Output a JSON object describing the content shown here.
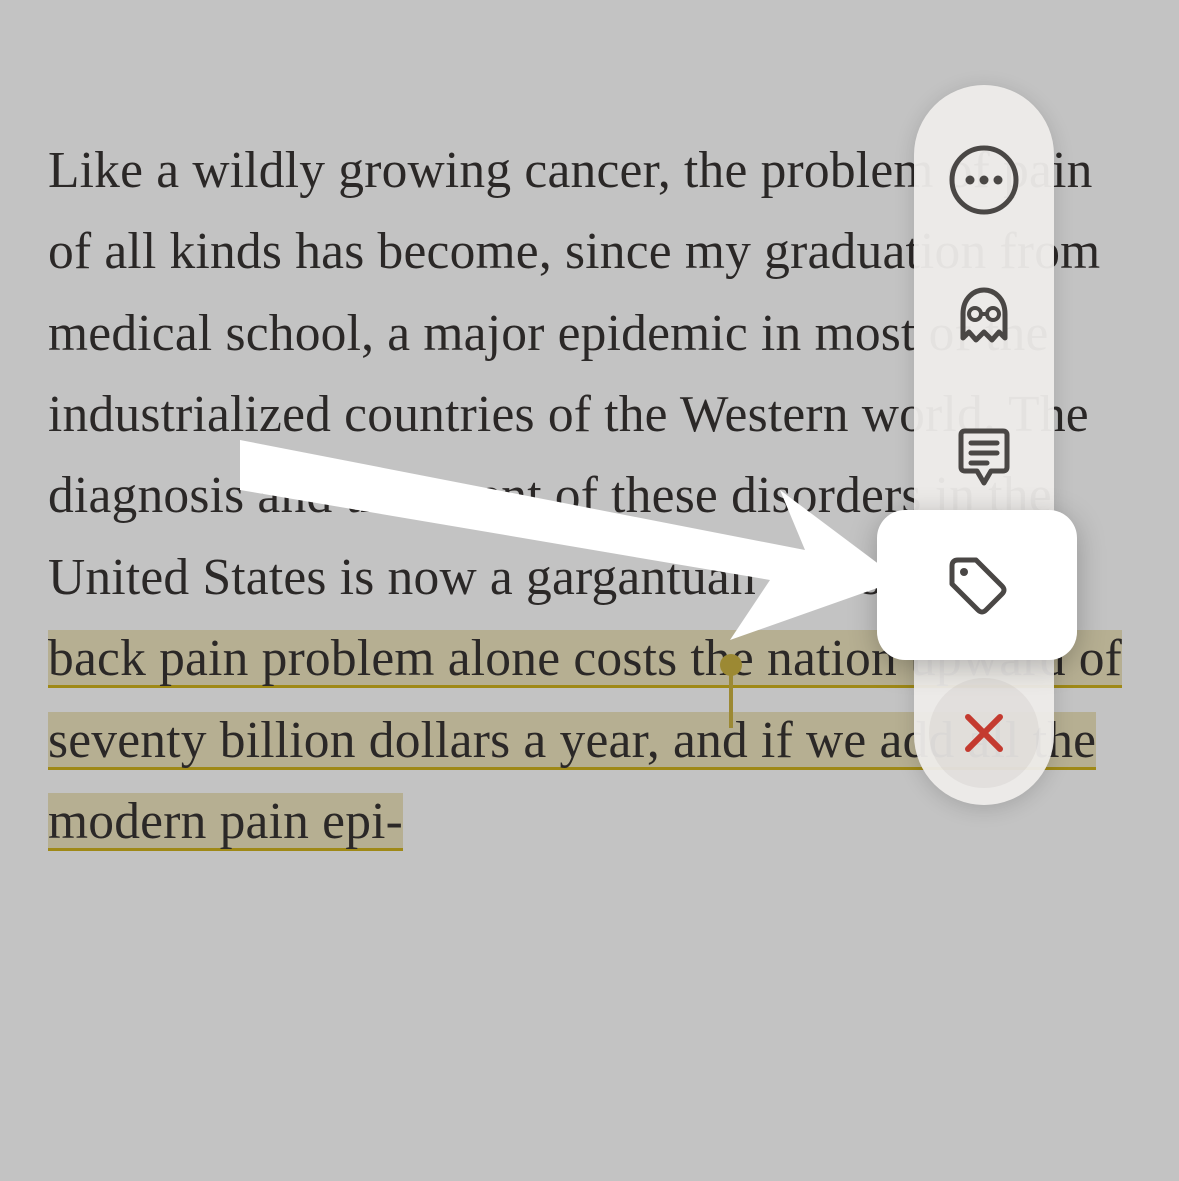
{
  "text": {
    "plain_before": "Like a wildly growing cancer, the prob­lem of pain of all kinds has become, since my graduation from medical school, a major epidemic in most of the industrialized countries of the Western world. The diagnosis and treatment of these disorders in the United States is now a gargantuan industry. ",
    "highlighted": "The back pain problem alone costs the nation upward of seventy billion dollars a year, and if we add all the modern pain epi-"
  },
  "toolbar": {
    "more": "more-options",
    "ghost": "ghost-reader",
    "note": "add-note",
    "tag": "add-tag",
    "close": "close"
  }
}
